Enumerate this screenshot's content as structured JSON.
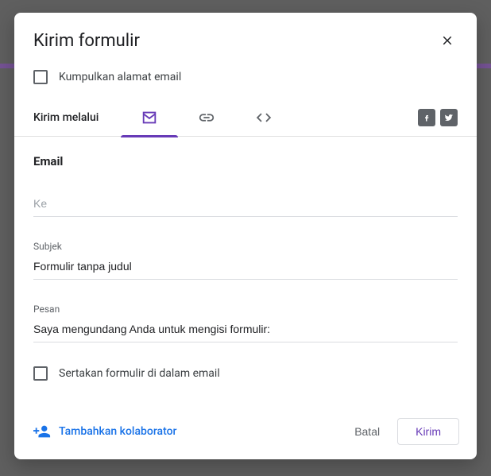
{
  "dialog": {
    "title": "Kirim formulir",
    "collect_label": "Kumpulkan alamat email",
    "send_via_label": "Kirim melalui"
  },
  "email": {
    "heading": "Email",
    "to_placeholder": "Ke",
    "to_value": "",
    "subject_label": "Subjek",
    "subject_value": "Formulir tanpa judul",
    "message_label": "Pesan",
    "message_value": "Saya mengundang Anda untuk mengisi formulir:",
    "include_label": "Sertakan formulir di dalam email"
  },
  "footer": {
    "add_collaborator": "Tambahkan kolaborator",
    "cancel": "Batal",
    "send": "Kirim"
  }
}
